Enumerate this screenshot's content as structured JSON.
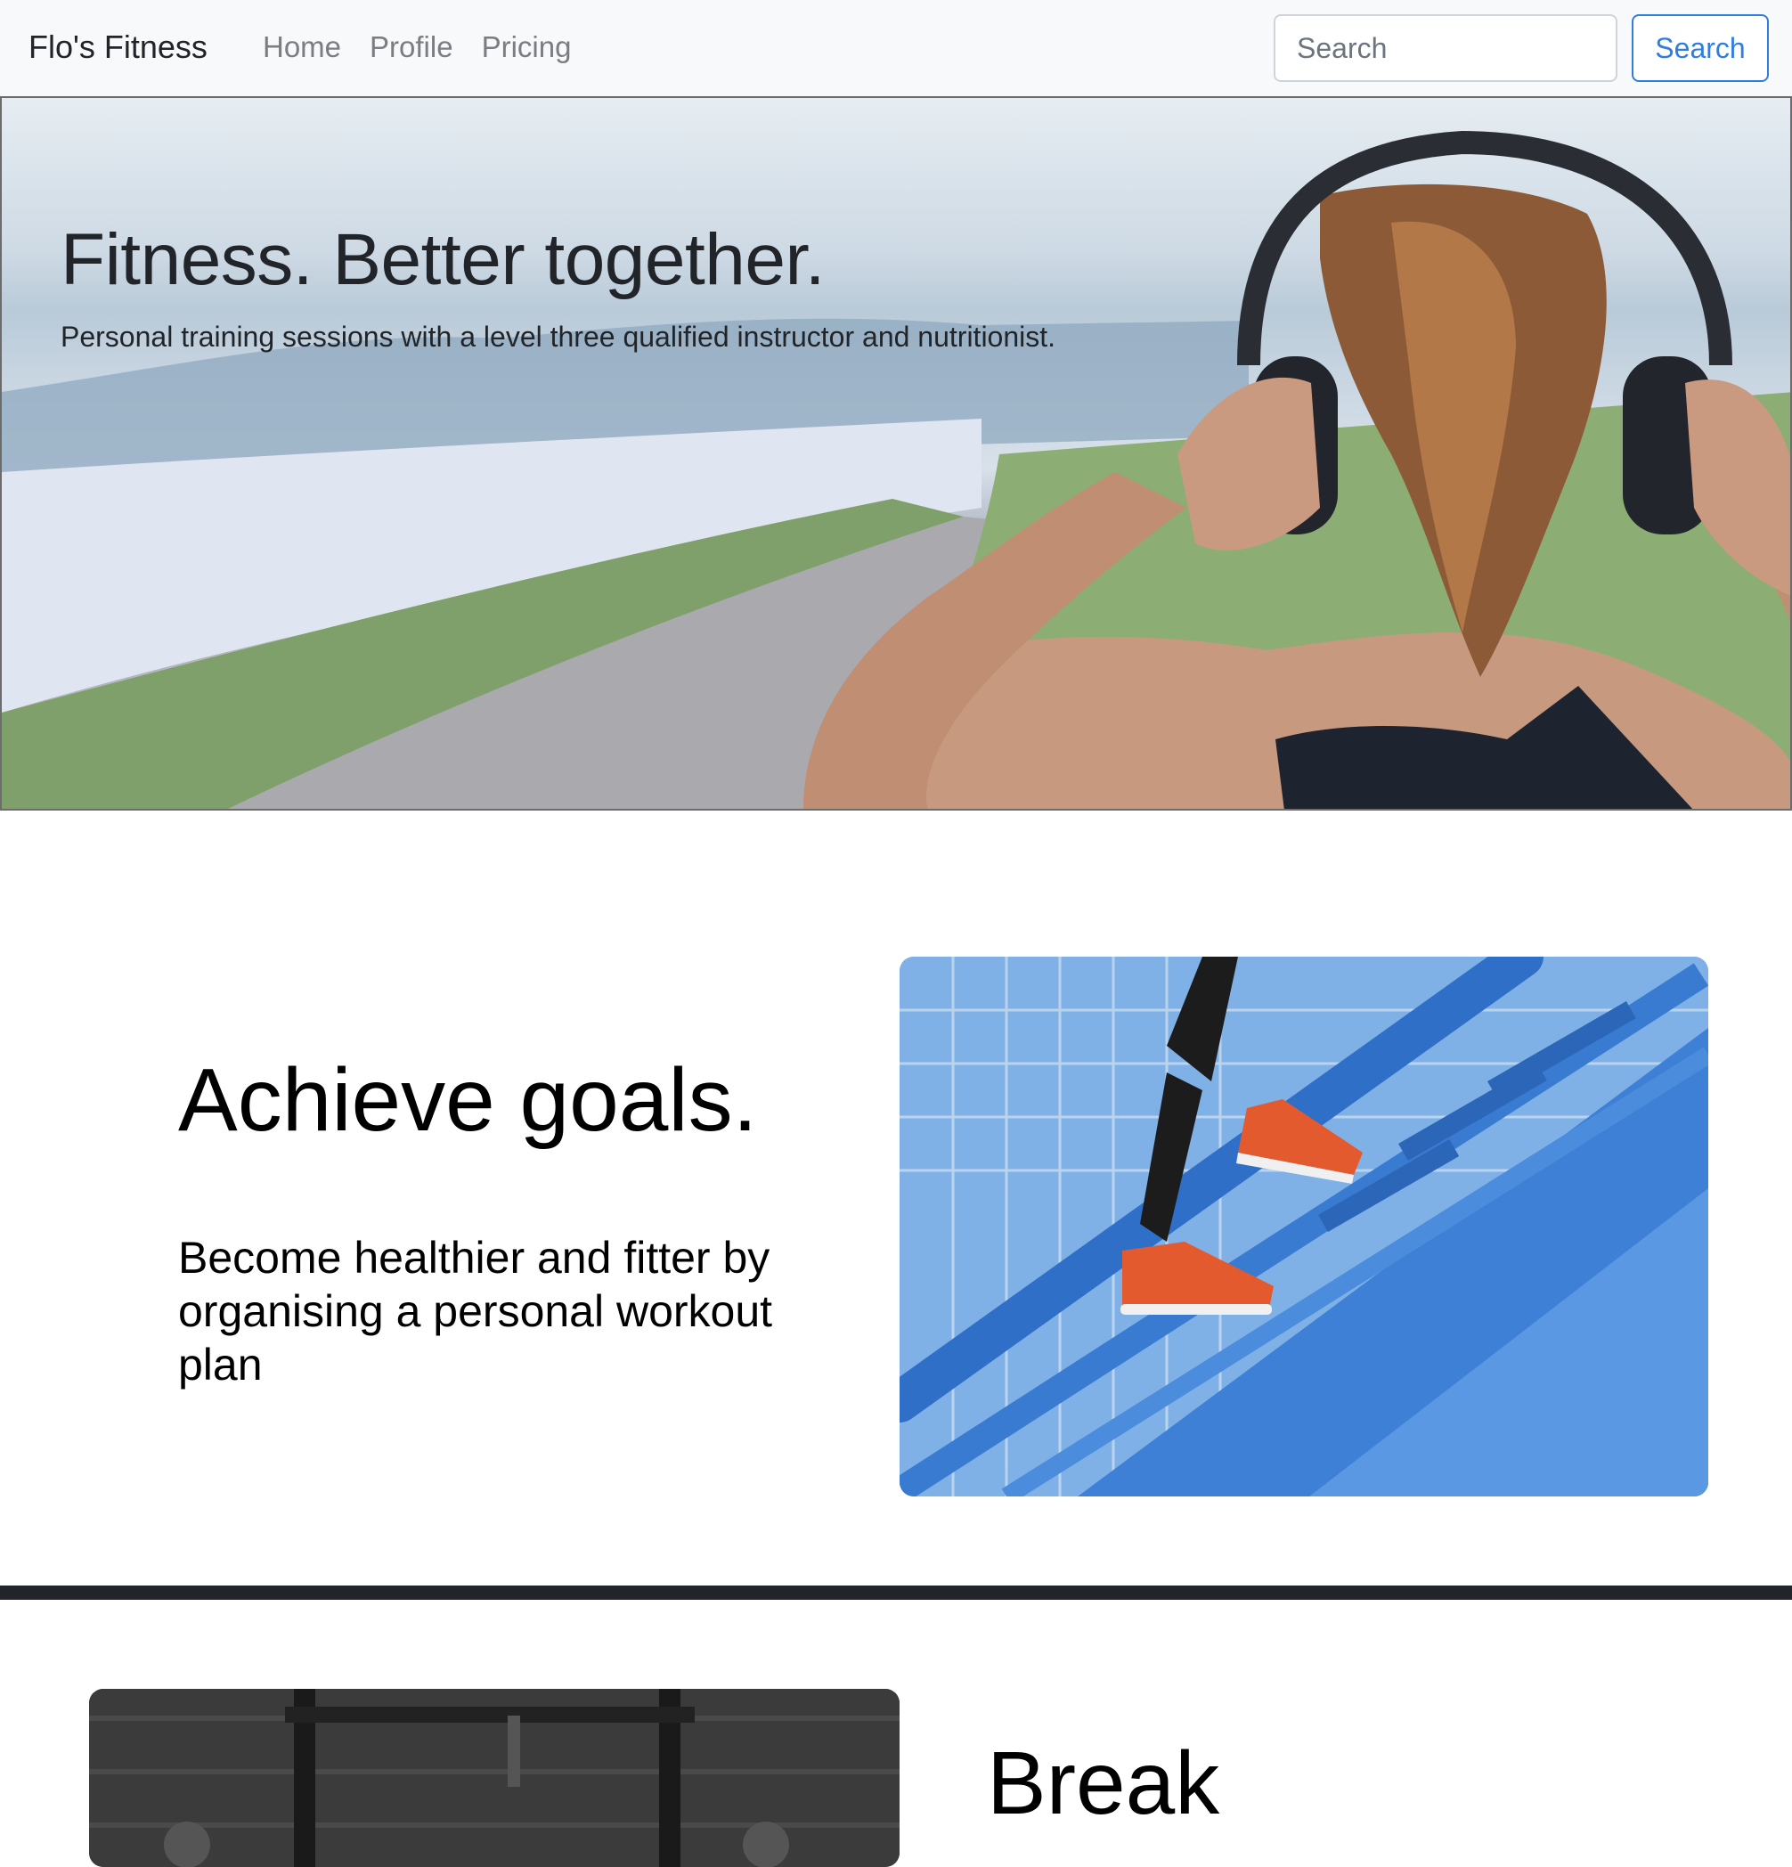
{
  "navbar": {
    "brand": "Flo's Fitness",
    "links": [
      "Home",
      "Profile",
      "Pricing"
    ],
    "search_placeholder": "Search",
    "search_button": "Search"
  },
  "hero": {
    "title": "Fitness. Better together.",
    "subtitle": "Personal training sessions with a level three qualified instructor and nutritionist."
  },
  "section_goals": {
    "title": "Achieve goals.",
    "text": "Become healthier and fitter by organising a personal workout plan"
  },
  "section_break": {
    "title": "Break"
  },
  "colors": {
    "accent": "#2f7de1",
    "divider": "#212529",
    "navbar_bg": "#f8f9fa"
  }
}
